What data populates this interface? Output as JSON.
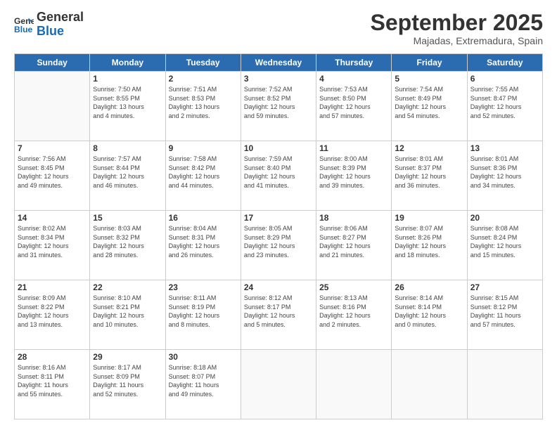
{
  "logo": {
    "line1": "General",
    "line2": "Blue"
  },
  "header": {
    "month": "September 2025",
    "location": "Majadas, Extremadura, Spain"
  },
  "days_of_week": [
    "Sunday",
    "Monday",
    "Tuesday",
    "Wednesday",
    "Thursday",
    "Friday",
    "Saturday"
  ],
  "weeks": [
    [
      {
        "num": "",
        "info": ""
      },
      {
        "num": "1",
        "info": "Sunrise: 7:50 AM\nSunset: 8:55 PM\nDaylight: 13 hours\nand 4 minutes."
      },
      {
        "num": "2",
        "info": "Sunrise: 7:51 AM\nSunset: 8:53 PM\nDaylight: 13 hours\nand 2 minutes."
      },
      {
        "num": "3",
        "info": "Sunrise: 7:52 AM\nSunset: 8:52 PM\nDaylight: 12 hours\nand 59 minutes."
      },
      {
        "num": "4",
        "info": "Sunrise: 7:53 AM\nSunset: 8:50 PM\nDaylight: 12 hours\nand 57 minutes."
      },
      {
        "num": "5",
        "info": "Sunrise: 7:54 AM\nSunset: 8:49 PM\nDaylight: 12 hours\nand 54 minutes."
      },
      {
        "num": "6",
        "info": "Sunrise: 7:55 AM\nSunset: 8:47 PM\nDaylight: 12 hours\nand 52 minutes."
      }
    ],
    [
      {
        "num": "7",
        "info": "Sunrise: 7:56 AM\nSunset: 8:45 PM\nDaylight: 12 hours\nand 49 minutes."
      },
      {
        "num": "8",
        "info": "Sunrise: 7:57 AM\nSunset: 8:44 PM\nDaylight: 12 hours\nand 46 minutes."
      },
      {
        "num": "9",
        "info": "Sunrise: 7:58 AM\nSunset: 8:42 PM\nDaylight: 12 hours\nand 44 minutes."
      },
      {
        "num": "10",
        "info": "Sunrise: 7:59 AM\nSunset: 8:40 PM\nDaylight: 12 hours\nand 41 minutes."
      },
      {
        "num": "11",
        "info": "Sunrise: 8:00 AM\nSunset: 8:39 PM\nDaylight: 12 hours\nand 39 minutes."
      },
      {
        "num": "12",
        "info": "Sunrise: 8:01 AM\nSunset: 8:37 PM\nDaylight: 12 hours\nand 36 minutes."
      },
      {
        "num": "13",
        "info": "Sunrise: 8:01 AM\nSunset: 8:36 PM\nDaylight: 12 hours\nand 34 minutes."
      }
    ],
    [
      {
        "num": "14",
        "info": "Sunrise: 8:02 AM\nSunset: 8:34 PM\nDaylight: 12 hours\nand 31 minutes."
      },
      {
        "num": "15",
        "info": "Sunrise: 8:03 AM\nSunset: 8:32 PM\nDaylight: 12 hours\nand 28 minutes."
      },
      {
        "num": "16",
        "info": "Sunrise: 8:04 AM\nSunset: 8:31 PM\nDaylight: 12 hours\nand 26 minutes."
      },
      {
        "num": "17",
        "info": "Sunrise: 8:05 AM\nSunset: 8:29 PM\nDaylight: 12 hours\nand 23 minutes."
      },
      {
        "num": "18",
        "info": "Sunrise: 8:06 AM\nSunset: 8:27 PM\nDaylight: 12 hours\nand 21 minutes."
      },
      {
        "num": "19",
        "info": "Sunrise: 8:07 AM\nSunset: 8:26 PM\nDaylight: 12 hours\nand 18 minutes."
      },
      {
        "num": "20",
        "info": "Sunrise: 8:08 AM\nSunset: 8:24 PM\nDaylight: 12 hours\nand 15 minutes."
      }
    ],
    [
      {
        "num": "21",
        "info": "Sunrise: 8:09 AM\nSunset: 8:22 PM\nDaylight: 12 hours\nand 13 minutes."
      },
      {
        "num": "22",
        "info": "Sunrise: 8:10 AM\nSunset: 8:21 PM\nDaylight: 12 hours\nand 10 minutes."
      },
      {
        "num": "23",
        "info": "Sunrise: 8:11 AM\nSunset: 8:19 PM\nDaylight: 12 hours\nand 8 minutes."
      },
      {
        "num": "24",
        "info": "Sunrise: 8:12 AM\nSunset: 8:17 PM\nDaylight: 12 hours\nand 5 minutes."
      },
      {
        "num": "25",
        "info": "Sunrise: 8:13 AM\nSunset: 8:16 PM\nDaylight: 12 hours\nand 2 minutes."
      },
      {
        "num": "26",
        "info": "Sunrise: 8:14 AM\nSunset: 8:14 PM\nDaylight: 12 hours\nand 0 minutes."
      },
      {
        "num": "27",
        "info": "Sunrise: 8:15 AM\nSunset: 8:12 PM\nDaylight: 11 hours\nand 57 minutes."
      }
    ],
    [
      {
        "num": "28",
        "info": "Sunrise: 8:16 AM\nSunset: 8:11 PM\nDaylight: 11 hours\nand 55 minutes."
      },
      {
        "num": "29",
        "info": "Sunrise: 8:17 AM\nSunset: 8:09 PM\nDaylight: 11 hours\nand 52 minutes."
      },
      {
        "num": "30",
        "info": "Sunrise: 8:18 AM\nSunset: 8:07 PM\nDaylight: 11 hours\nand 49 minutes."
      },
      {
        "num": "",
        "info": ""
      },
      {
        "num": "",
        "info": ""
      },
      {
        "num": "",
        "info": ""
      },
      {
        "num": "",
        "info": ""
      }
    ]
  ]
}
